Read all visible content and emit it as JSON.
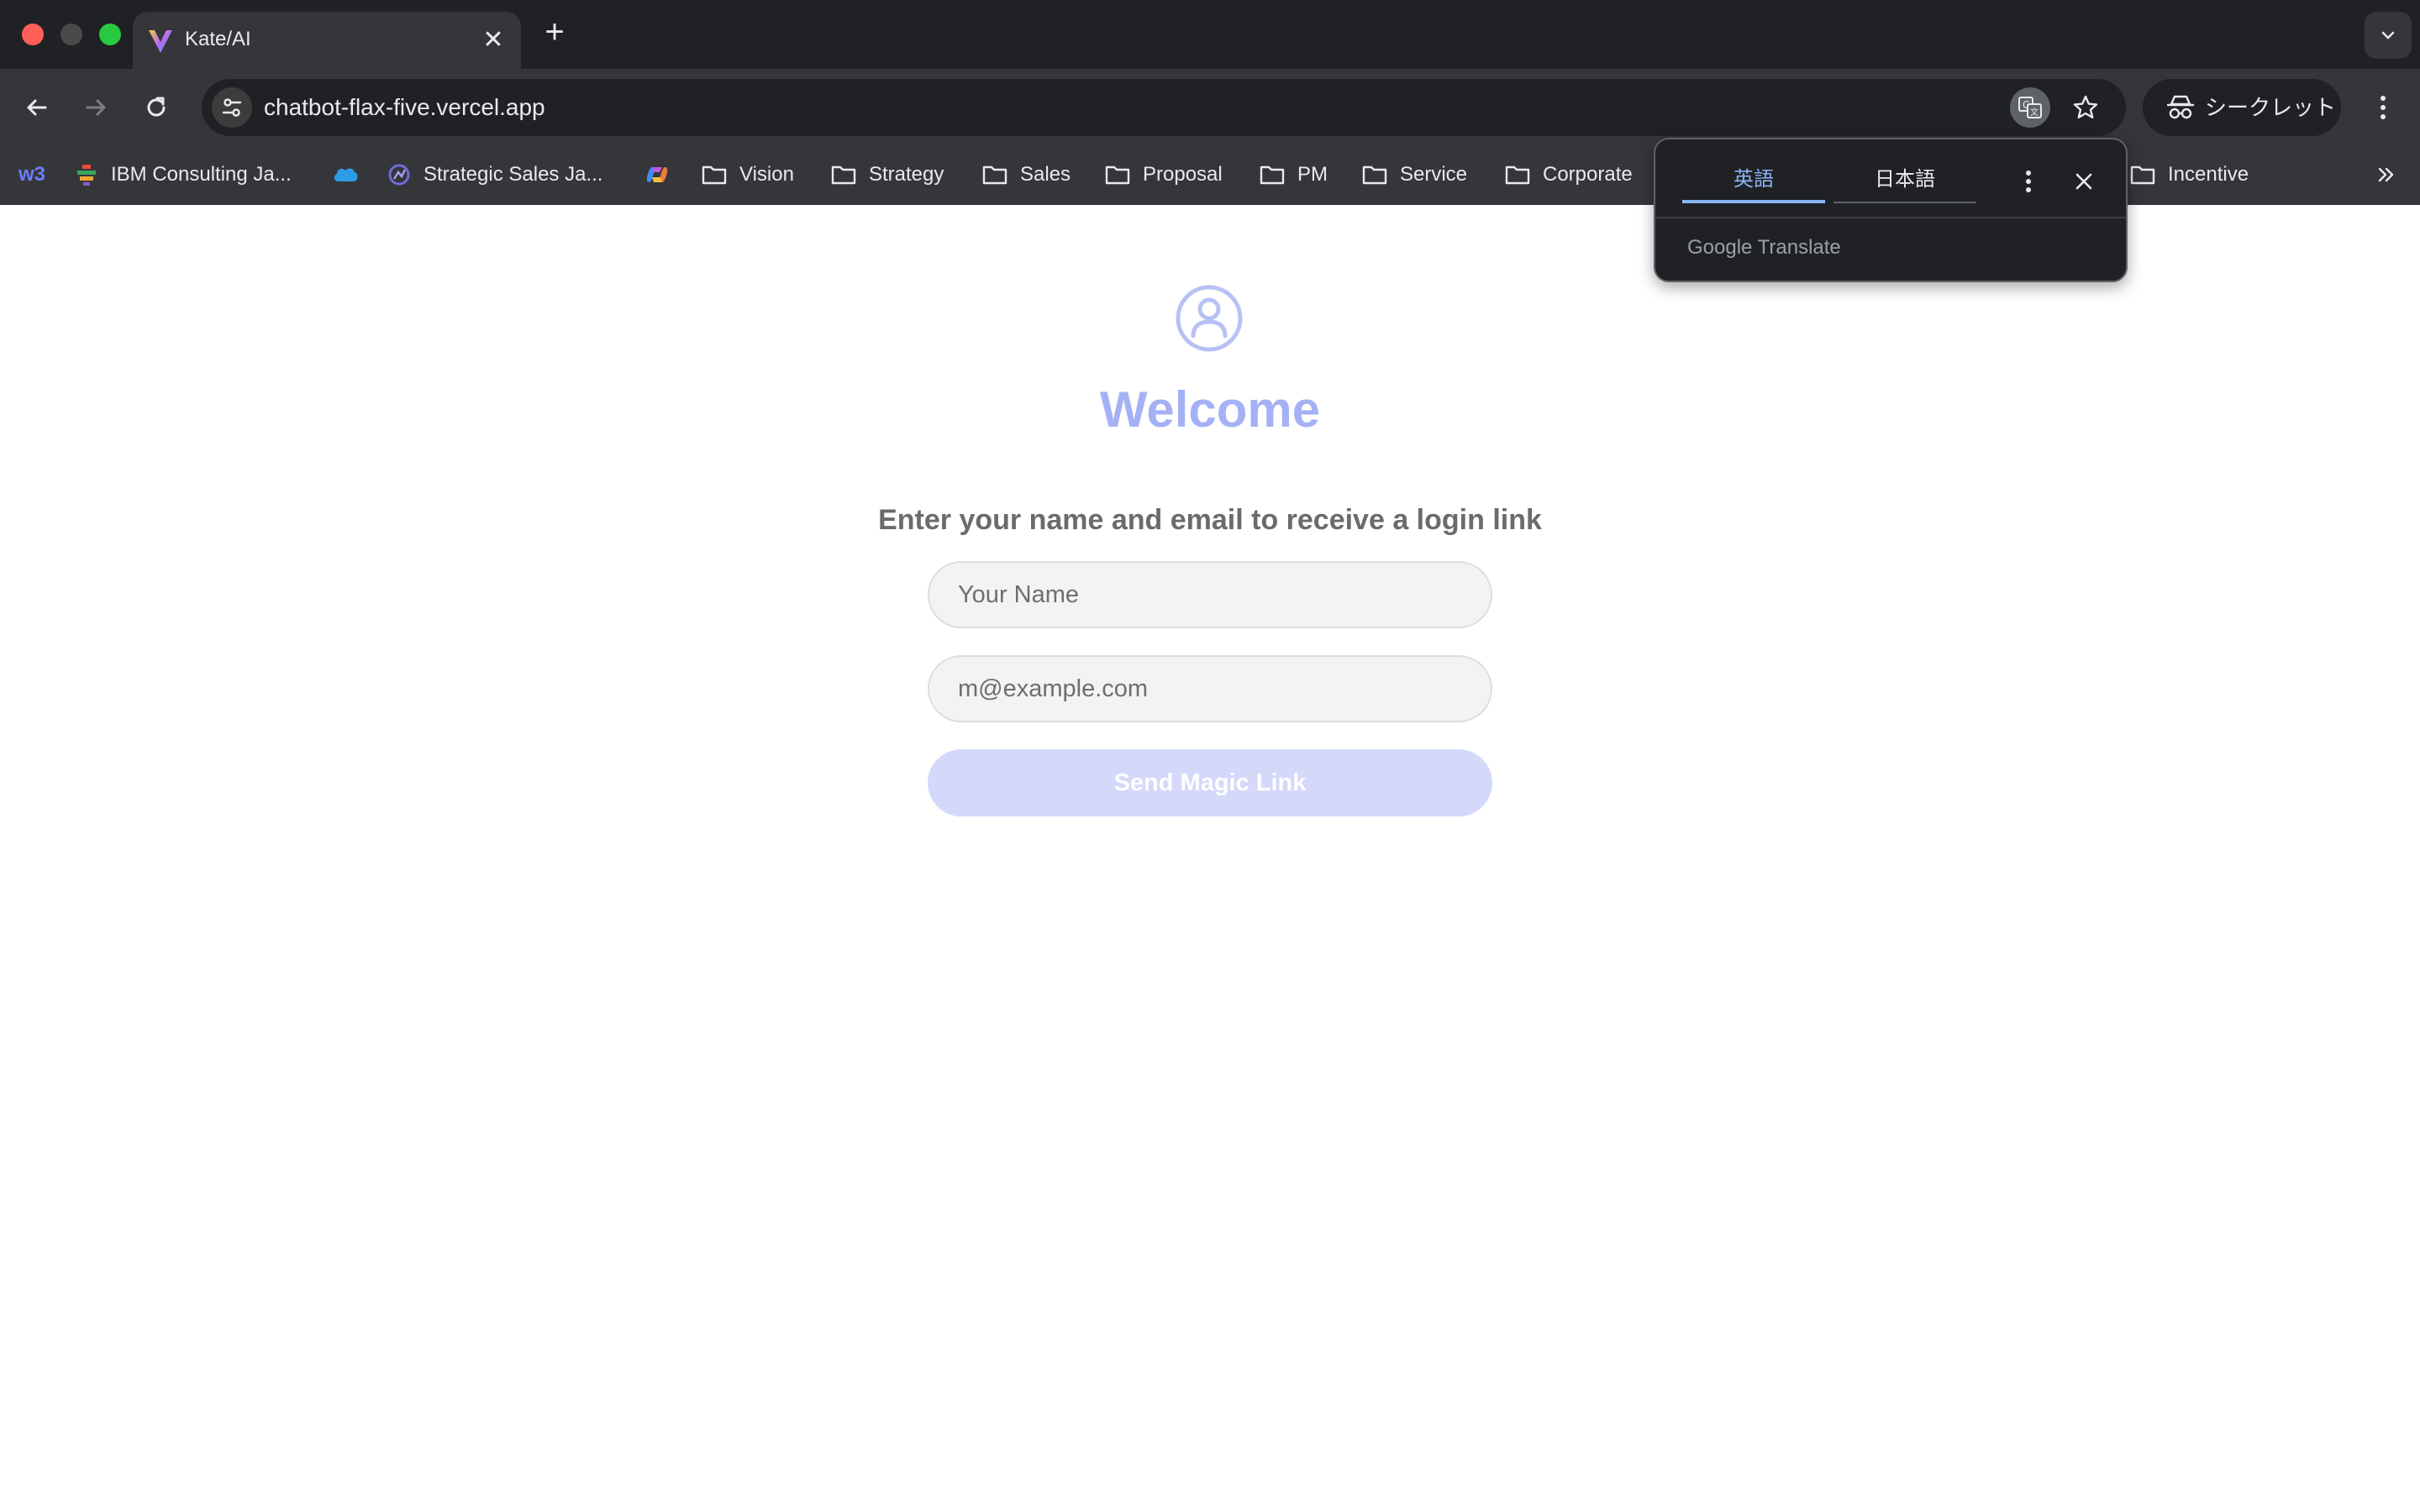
{
  "browser": {
    "tab": {
      "title": "Kate/AI",
      "close_glyph": "✕",
      "icon": "vercel-v-icon"
    },
    "new_tab_glyph": "+",
    "url": "chatbot-flax-five.vercel.app",
    "incognito_label": "シークレット",
    "bookmarks": [
      {
        "label": "w3",
        "icon": "w3-icon"
      },
      {
        "label": "IBM Consulting Ja...",
        "icon": "ibm-bee-icon"
      },
      {
        "label": "",
        "icon": "salesforce-cloud-icon"
      },
      {
        "label": "Strategic Sales Ja...",
        "icon": "strategic-icon"
      },
      {
        "label": "",
        "icon": "copilot-icon"
      },
      {
        "label": "Vision",
        "icon": "folder-icon"
      },
      {
        "label": "Strategy",
        "icon": "folder-icon"
      },
      {
        "label": "Sales",
        "icon": "folder-icon"
      },
      {
        "label": "Proposal",
        "icon": "folder-icon"
      },
      {
        "label": "PM",
        "icon": "folder-icon"
      },
      {
        "label": "Service",
        "icon": "folder-icon"
      },
      {
        "label": "Corporate",
        "icon": "folder-icon"
      },
      {
        "label": "Incentive",
        "icon": "folder-icon"
      }
    ]
  },
  "translate_popup": {
    "source_lang": "英語",
    "target_lang": "日本語",
    "brand": "Google Translate"
  },
  "page": {
    "title": "Welcome",
    "subtitle": "Enter your name and email to receive a login link",
    "name_placeholder": "Your Name",
    "email_placeholder": "m@example.com",
    "submit_label": "Send Magic Link"
  },
  "colors": {
    "accent": "#a5b1f5",
    "button_disabled": "#d4d9fa",
    "chrome_dark": "#202124",
    "chrome_toolbar": "#35363a"
  }
}
